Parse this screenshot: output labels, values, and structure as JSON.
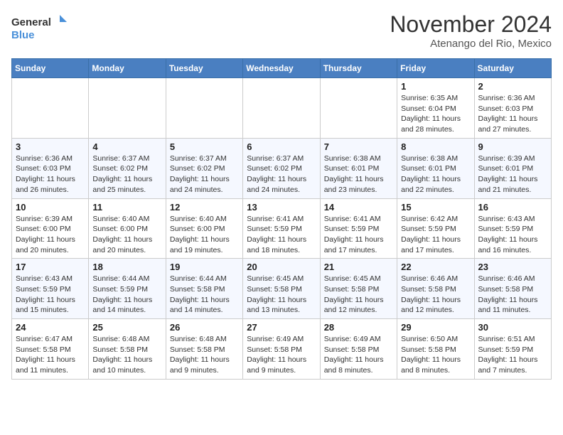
{
  "logo": {
    "line1": "General",
    "line2": "Blue"
  },
  "title": "November 2024",
  "subtitle": "Atenango del Rio, Mexico",
  "days_of_week": [
    "Sunday",
    "Monday",
    "Tuesday",
    "Wednesday",
    "Thursday",
    "Friday",
    "Saturday"
  ],
  "weeks": [
    [
      {
        "num": "",
        "info": ""
      },
      {
        "num": "",
        "info": ""
      },
      {
        "num": "",
        "info": ""
      },
      {
        "num": "",
        "info": ""
      },
      {
        "num": "",
        "info": ""
      },
      {
        "num": "1",
        "info": "Sunrise: 6:35 AM\nSunset: 6:04 PM\nDaylight: 11 hours and 28 minutes."
      },
      {
        "num": "2",
        "info": "Sunrise: 6:36 AM\nSunset: 6:03 PM\nDaylight: 11 hours and 27 minutes."
      }
    ],
    [
      {
        "num": "3",
        "info": "Sunrise: 6:36 AM\nSunset: 6:03 PM\nDaylight: 11 hours and 26 minutes."
      },
      {
        "num": "4",
        "info": "Sunrise: 6:37 AM\nSunset: 6:02 PM\nDaylight: 11 hours and 25 minutes."
      },
      {
        "num": "5",
        "info": "Sunrise: 6:37 AM\nSunset: 6:02 PM\nDaylight: 11 hours and 24 minutes."
      },
      {
        "num": "6",
        "info": "Sunrise: 6:37 AM\nSunset: 6:02 PM\nDaylight: 11 hours and 24 minutes."
      },
      {
        "num": "7",
        "info": "Sunrise: 6:38 AM\nSunset: 6:01 PM\nDaylight: 11 hours and 23 minutes."
      },
      {
        "num": "8",
        "info": "Sunrise: 6:38 AM\nSunset: 6:01 PM\nDaylight: 11 hours and 22 minutes."
      },
      {
        "num": "9",
        "info": "Sunrise: 6:39 AM\nSunset: 6:01 PM\nDaylight: 11 hours and 21 minutes."
      }
    ],
    [
      {
        "num": "10",
        "info": "Sunrise: 6:39 AM\nSunset: 6:00 PM\nDaylight: 11 hours and 20 minutes."
      },
      {
        "num": "11",
        "info": "Sunrise: 6:40 AM\nSunset: 6:00 PM\nDaylight: 11 hours and 20 minutes."
      },
      {
        "num": "12",
        "info": "Sunrise: 6:40 AM\nSunset: 6:00 PM\nDaylight: 11 hours and 19 minutes."
      },
      {
        "num": "13",
        "info": "Sunrise: 6:41 AM\nSunset: 5:59 PM\nDaylight: 11 hours and 18 minutes."
      },
      {
        "num": "14",
        "info": "Sunrise: 6:41 AM\nSunset: 5:59 PM\nDaylight: 11 hours and 17 minutes."
      },
      {
        "num": "15",
        "info": "Sunrise: 6:42 AM\nSunset: 5:59 PM\nDaylight: 11 hours and 17 minutes."
      },
      {
        "num": "16",
        "info": "Sunrise: 6:43 AM\nSunset: 5:59 PM\nDaylight: 11 hours and 16 minutes."
      }
    ],
    [
      {
        "num": "17",
        "info": "Sunrise: 6:43 AM\nSunset: 5:59 PM\nDaylight: 11 hours and 15 minutes."
      },
      {
        "num": "18",
        "info": "Sunrise: 6:44 AM\nSunset: 5:59 PM\nDaylight: 11 hours and 14 minutes."
      },
      {
        "num": "19",
        "info": "Sunrise: 6:44 AM\nSunset: 5:58 PM\nDaylight: 11 hours and 14 minutes."
      },
      {
        "num": "20",
        "info": "Sunrise: 6:45 AM\nSunset: 5:58 PM\nDaylight: 11 hours and 13 minutes."
      },
      {
        "num": "21",
        "info": "Sunrise: 6:45 AM\nSunset: 5:58 PM\nDaylight: 11 hours and 12 minutes."
      },
      {
        "num": "22",
        "info": "Sunrise: 6:46 AM\nSunset: 5:58 PM\nDaylight: 11 hours and 12 minutes."
      },
      {
        "num": "23",
        "info": "Sunrise: 6:46 AM\nSunset: 5:58 PM\nDaylight: 11 hours and 11 minutes."
      }
    ],
    [
      {
        "num": "24",
        "info": "Sunrise: 6:47 AM\nSunset: 5:58 PM\nDaylight: 11 hours and 11 minutes."
      },
      {
        "num": "25",
        "info": "Sunrise: 6:48 AM\nSunset: 5:58 PM\nDaylight: 11 hours and 10 minutes."
      },
      {
        "num": "26",
        "info": "Sunrise: 6:48 AM\nSunset: 5:58 PM\nDaylight: 11 hours and 9 minutes."
      },
      {
        "num": "27",
        "info": "Sunrise: 6:49 AM\nSunset: 5:58 PM\nDaylight: 11 hours and 9 minutes."
      },
      {
        "num": "28",
        "info": "Sunrise: 6:49 AM\nSunset: 5:58 PM\nDaylight: 11 hours and 8 minutes."
      },
      {
        "num": "29",
        "info": "Sunrise: 6:50 AM\nSunset: 5:58 PM\nDaylight: 11 hours and 8 minutes."
      },
      {
        "num": "30",
        "info": "Sunrise: 6:51 AM\nSunset: 5:59 PM\nDaylight: 11 hours and 7 minutes."
      }
    ]
  ]
}
